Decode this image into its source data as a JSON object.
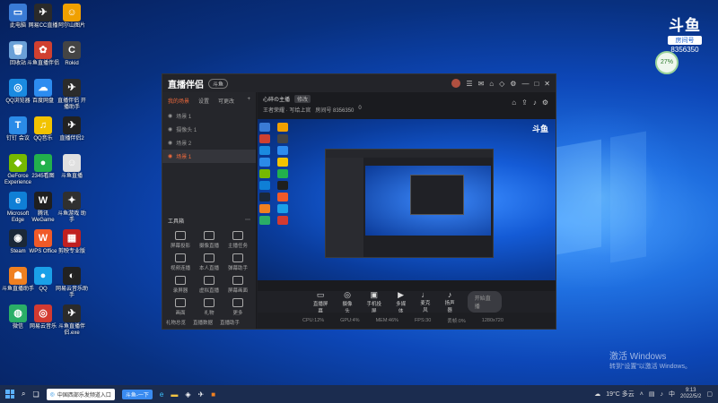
{
  "desktop_icons": [
    {
      "label": "此电脑",
      "color": "#3a7bd5",
      "glyph": "▭"
    },
    {
      "label": "网易CC直播",
      "color": "#2a2a2a",
      "glyph": "✈"
    },
    {
      "label": "阿尔山图片",
      "color": "#f0a000",
      "glyph": "☺"
    },
    {
      "label": "回收站",
      "color": "#6aa0d8",
      "glyph": "🗑"
    },
    {
      "label": "斗鱼直播伴侣",
      "color": "#d04030",
      "glyph": "✿"
    },
    {
      "label": "Rokid",
      "color": "#444",
      "glyph": "C"
    },
    {
      "label": "QQ浏览器",
      "color": "#1a8ae0",
      "glyph": "◎"
    },
    {
      "label": "百度网盘",
      "color": "#2d8cf0",
      "glyph": "☁"
    },
    {
      "label": "直播伴侣 开播助手",
      "color": "#2b2b2b",
      "glyph": "✈"
    },
    {
      "label": "钉钉 会议",
      "color": "#2b8be8",
      "glyph": "T"
    },
    {
      "label": "QQ音乐",
      "color": "#f2c300",
      "glyph": "♫"
    },
    {
      "label": "直播伴侣2",
      "color": "#222",
      "glyph": "✈"
    },
    {
      "label": "GeForce Experience",
      "color": "#76b900",
      "glyph": "◆"
    },
    {
      "label": "2345看图",
      "color": "#22b14c",
      "glyph": "●"
    },
    {
      "label": "斗鱼直播",
      "color": "#e0e0e0",
      "glyph": "☺"
    },
    {
      "label": "Microsoft Edge",
      "color": "#0f7fd6",
      "glyph": "e"
    },
    {
      "label": "腾讯 WeGame",
      "color": "#1f1f1f",
      "glyph": "W"
    },
    {
      "label": "斗鱼游戏 助手",
      "color": "#303030",
      "glyph": "✦"
    },
    {
      "label": "Steam",
      "color": "#1b2838",
      "glyph": "◉"
    },
    {
      "label": "WPS Office",
      "color": "#f05a28",
      "glyph": "W"
    },
    {
      "label": "剪映专业版",
      "color": "#c02020",
      "glyph": "▦"
    },
    {
      "label": "斗鱼直播助手",
      "color": "#f08020",
      "glyph": "☗"
    },
    {
      "label": "QQ",
      "color": "#1aa0e8",
      "glyph": "●"
    },
    {
      "label": "网易云音乐助手",
      "color": "#222",
      "glyph": "◐"
    },
    {
      "label": "微信",
      "color": "#2aae67",
      "glyph": "◍"
    },
    {
      "label": "网易云音乐",
      "color": "#d33a31",
      "glyph": "◎"
    },
    {
      "label": "斗鱼直播伴侣.exe",
      "color": "#2b2b2b",
      "glyph": "✈"
    }
  ],
  "douyu": {
    "logo": "斗鱼",
    "sub": "房间号",
    "room_number": "8356350"
  },
  "progress_badge": "27%",
  "app": {
    "brand": "直播伴侣",
    "version": "斗鱼",
    "left_tabs": [
      "我的场景",
      "设置",
      "可更改"
    ],
    "scenes": [
      "场景 1",
      "摄像头 1",
      "场景 2",
      "场景 1"
    ],
    "active_scene": "场景 1",
    "tools_title": "工具箱",
    "tools": [
      "屏幕投影",
      "摄像直播",
      "主播任务",
      "视频连播",
      "本人直播",
      "弹幕助手",
      "录屏器",
      "虚拟直播",
      "屏幕画面",
      "画面",
      "礼物",
      "更多"
    ],
    "left_bottom": [
      "礼物总览",
      "直播数据",
      "直播助手"
    ],
    "room_title": "心碎の主播",
    "room_tag": "修改",
    "room_info": [
      "王者荣耀 · 写给上官",
      "房间号 8356350",
      "0"
    ],
    "controls": [
      "直播屏幕",
      "摄像头",
      "手机投屏",
      "多媒体",
      "麦克风",
      "扬声器"
    ],
    "go_live": "开始直播",
    "status": [
      "CPU:12%",
      "GPU:4%",
      "MEM:46%",
      "FPS:30",
      "丢帧:0%",
      "1280x720"
    ]
  },
  "watermark": {
    "line1": "激活 Windows",
    "line2": "转到“设置”以激活 Windows。"
  },
  "taskbar": {
    "app_label": "中国西部乐发频道入口",
    "app_button": "斗鱼-一下",
    "weather": "19°C 多云",
    "time": "9:13",
    "date": "2022/5/2",
    "lang": "中"
  }
}
